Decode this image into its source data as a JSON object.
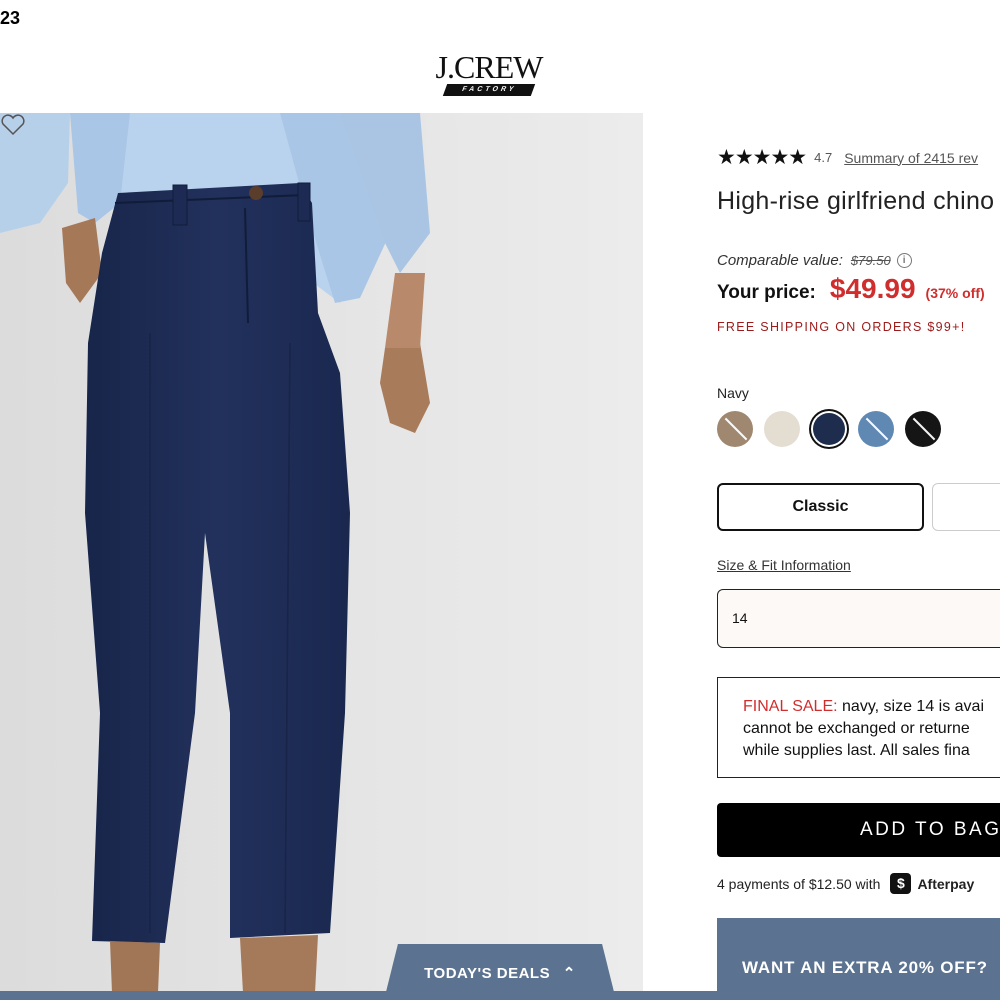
{
  "corner": {
    "text": "23"
  },
  "header": {
    "logo_main": "J.CREW",
    "logo_sub": "FACTORY"
  },
  "colors": {
    "accent_red": "#d02e2e",
    "promo_blue": "#5b7290",
    "navy": "#1e2d4e"
  },
  "product": {
    "stars": "★★★★★",
    "rating": "4.7",
    "reviews_link": "Summary of 2415 rev",
    "title": "High-rise girlfriend chino",
    "comparable_label": "Comparable value:",
    "comparable_price": "$79.50",
    "your_price_label": "Your price:",
    "price": "$49.99",
    "discount": "(37% off)",
    "shipping": "FREE SHIPPING ON ORDERS $99+!",
    "selected_color": "Navy",
    "swatches": [
      {
        "name": "khaki",
        "color": "#a08870",
        "selected": false
      },
      {
        "name": "stone",
        "color": "#e4ddd2",
        "selected": false
      },
      {
        "name": "navy",
        "color": "#1e2d4e",
        "selected": true
      },
      {
        "name": "blue",
        "color": "#5f88b3",
        "selected": false
      },
      {
        "name": "black",
        "color": "#151515",
        "selected": false
      }
    ],
    "fit_options": [
      "Classic",
      ""
    ],
    "size_info_link": "Size & Fit Information",
    "size_value": "14",
    "final_sale_label": "FINAL SALE:",
    "final_sale_line1": "navy, size 14 is avai",
    "final_sale_line2": "cannot be exchanged or returne",
    "final_sale_line3": "while supplies last. All sales fina",
    "add_to_bag": "ADD TO BAG",
    "installments": "4 payments of $12.50 with",
    "afterpay_badge": "$",
    "afterpay_name": "Afterpay"
  },
  "promo": {
    "text": "WANT AN EXTRA 20% OFF?"
  },
  "deals": {
    "label": "TODAY'S DEALS",
    "chevron": "⌃"
  },
  "icons": {
    "favorite": "heart-icon",
    "info": "info-icon",
    "chevron": "chevron-up-icon"
  }
}
